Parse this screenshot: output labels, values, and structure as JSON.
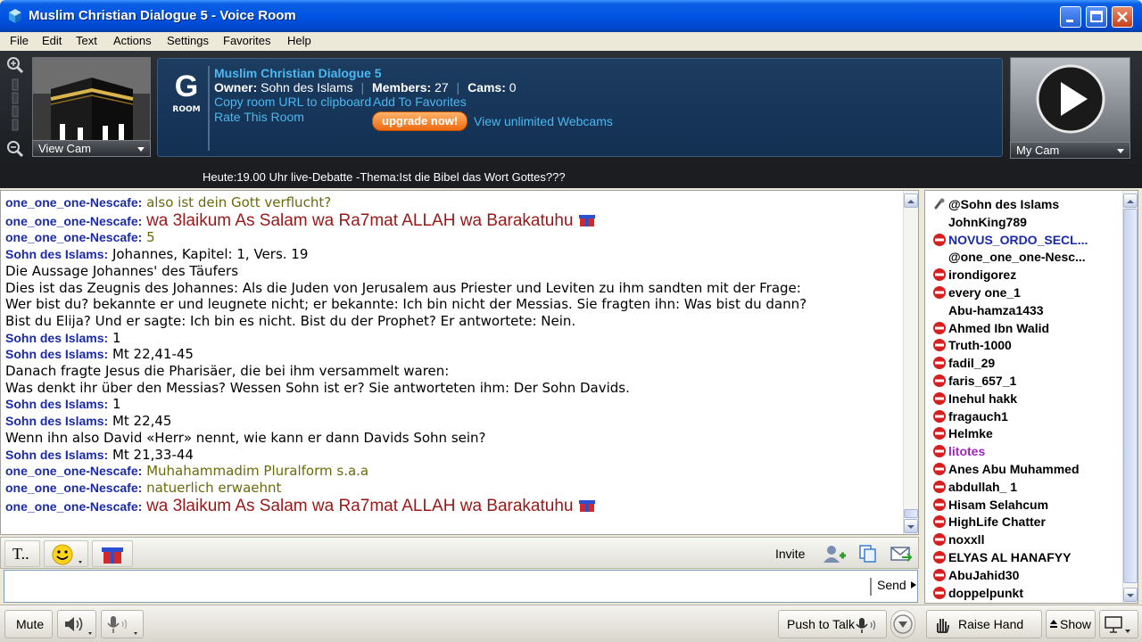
{
  "window": {
    "title": "Muslim Christian Dialogue 5 - Voice Room"
  },
  "menu": [
    "File",
    "Edit",
    "Text",
    "Actions",
    "Settings",
    "Favorites",
    "Help"
  ],
  "cam": {
    "view_label": "View Cam",
    "my_label": "My Cam"
  },
  "room": {
    "logo_letter": "G",
    "logo_sub": "ROOM",
    "name": "Muslim Christian Dialogue 5",
    "owner_label": "Owner:",
    "owner": "Sohn des Islams",
    "members_label": "Members:",
    "members": "27",
    "cams_label": "Cams:",
    "cams": "0",
    "copy_url": "Copy room URL to clipboard",
    "add_fav": "Add To Favorites",
    "rate": "Rate This Room",
    "upgrade": "upgrade now!",
    "webcams": "View unlimited Webcams"
  },
  "topic": "Heute:19.00 Uhr live-Debatte -Thema:Ist die Bibel das Wort Gottes???",
  "chat": [
    {
      "nick": "one_one_one-Nescafe:",
      "text": "also ist dein Gott verflucht?",
      "style": "olive"
    },
    {
      "nick": "one_one_one-Nescafe:",
      "text": "wa 3laikum As Salam wa Ra7mat ALLAH wa Barakatuhu",
      "style": "big",
      "gift": true
    },
    {
      "nick": "one_one_one-Nescafe:",
      "text": "5",
      "style": "olive"
    },
    {
      "nick": "Sohn des Islams:",
      "text": "Johannes, Kapitel: 1,  Vers. 19",
      "style": "plain"
    },
    {
      "nick": "",
      "text": "Die Aussage Johannes' des Täufers",
      "style": "plain"
    },
    {
      "nick": "",
      "text": "Dies ist das Zeugnis des Johannes: Als die Juden von Jerusalem aus Priester und Leviten zu ihm sandten mit der Frage:",
      "style": "plain"
    },
    {
      "nick": "",
      "text": "Wer bist du? bekannte er und leugnete nicht; er bekannte: Ich bin nicht der Messias. Sie fragten ihn: Was bist du dann?",
      "style": "plain"
    },
    {
      "nick": "",
      "text": "Bist du Elija? Und er sagte: Ich bin es nicht. Bist du der Prophet? Er antwortete: Nein.",
      "style": "plain"
    },
    {
      "nick": "Sohn des Islams:",
      "text": "1",
      "style": "plain"
    },
    {
      "nick": "Sohn des Islams:",
      "text": "Mt 22,41-45",
      "style": "plain"
    },
    {
      "nick": "",
      "text": "Danach fragte Jesus die Pharisäer, die bei ihm versammelt waren:",
      "style": "plain"
    },
    {
      "nick": "",
      "text": "Was denkt ihr über den Messias? Wessen Sohn ist er? Sie antworteten ihm: Der Sohn Davids.",
      "style": "plain"
    },
    {
      "nick": "Sohn des Islams:",
      "text": "1",
      "style": "plain"
    },
    {
      "nick": "Sohn des Islams:",
      "text": "Mt 22,45",
      "style": "plain"
    },
    {
      "nick": "",
      "text": "Wenn ihn also David «Herr» nennt, wie kann er dann Davids Sohn sein?",
      "style": "plain"
    },
    {
      "nick": "Sohn des Islams:",
      "text": "Mt 21,33-44",
      "style": "plain"
    },
    {
      "nick": "one_one_one-Nescafe:",
      "text": "Muhahammadim Pluralform s.a.a",
      "style": "olive"
    },
    {
      "nick": "one_one_one-Nescafe:",
      "text": "natuerlich erwaehnt",
      "style": "olive"
    },
    {
      "nick": "one_one_one-Nescafe:",
      "text": "wa 3laikum As Salam wa Ra7mat ALLAH wa Barakatuhu",
      "style": "big",
      "gift": true
    }
  ],
  "toolbar": {
    "text_btn": "T..",
    "invite": "Invite"
  },
  "input": {
    "value": "",
    "send": "Send"
  },
  "bottom": {
    "mute": "Mute",
    "push_to_talk": "Push to Talk",
    "raise_hand": "Raise Hand",
    "show": "Show"
  },
  "users": [
    {
      "name": "@Sohn des Islams",
      "icon": "mic",
      "color": "#000000"
    },
    {
      "name": "JohnKing789",
      "icon": "none",
      "color": "#000000"
    },
    {
      "name": "NOVUS_ORDO_SECL...",
      "icon": "red",
      "color": "#1a2aa8"
    },
    {
      "name": "@one_one_one-Nesc...",
      "icon": "none",
      "color": "#000000"
    },
    {
      "name": "irondigorez",
      "icon": "red",
      "color": "#000000"
    },
    {
      "name": "every one_1",
      "icon": "red",
      "color": "#000000"
    },
    {
      "name": "Abu-hamza1433",
      "icon": "none",
      "color": "#000000"
    },
    {
      "name": "Ahmed Ibn Walid",
      "icon": "red",
      "color": "#000000"
    },
    {
      "name": "Truth-1000",
      "icon": "red",
      "color": "#000000"
    },
    {
      "name": "fadil_29",
      "icon": "red",
      "color": "#000000"
    },
    {
      "name": "faris_657_1",
      "icon": "red",
      "color": "#000000"
    },
    {
      "name": "Inehul hakk",
      "icon": "red",
      "color": "#000000"
    },
    {
      "name": "fragauch1",
      "icon": "red",
      "color": "#000000"
    },
    {
      "name": "Helmke",
      "icon": "red",
      "color": "#000000"
    },
    {
      "name": "litotes",
      "icon": "red",
      "color": "#9b2ab8"
    },
    {
      "name": "Anes Abu Muhammed",
      "icon": "red",
      "color": "#000000"
    },
    {
      "name": "abdullah_ 1",
      "icon": "red",
      "color": "#000000"
    },
    {
      "name": "Hisam Selahcum",
      "icon": "red",
      "color": "#000000"
    },
    {
      "name": "HighLife Chatter",
      "icon": "red",
      "color": "#000000"
    },
    {
      "name": "noxxll",
      "icon": "red",
      "color": "#000000"
    },
    {
      "name": "ELYAS AL HANAFYY",
      "icon": "red",
      "color": "#000000"
    },
    {
      "name": "AbuJahid30",
      "icon": "red",
      "color": "#000000"
    },
    {
      "name": "doppelpunkt",
      "icon": "red",
      "color": "#000000"
    }
  ]
}
